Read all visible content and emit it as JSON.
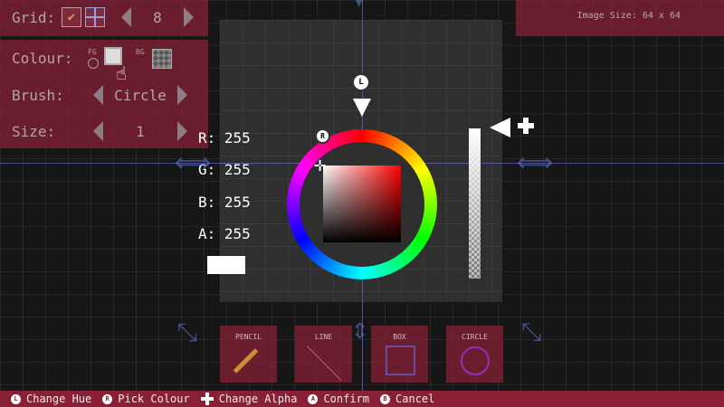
{
  "editor": {
    "grid_label": "Grid:",
    "grid_value": "8",
    "colour_label": "Colour:",
    "fg_label": "FG",
    "bg_label": "BG",
    "brush_label": "Brush:",
    "brush_value": "Circle",
    "size_label": "Size:",
    "size_value": "1",
    "image_size": "Image Size: 64 x 64"
  },
  "color_picker": {
    "r_text": "R: 255",
    "g_text": "G: 255",
    "b_text": "B: 255",
    "a_text": "A: 255",
    "l_badge": "L",
    "r_badge": "R",
    "current_color": "#ffffff",
    "hue_color": "#ff0000"
  },
  "tools": {
    "pencil": "PENCIL",
    "line": "LINE",
    "box": "BOX",
    "circle": "CIRCLE"
  },
  "footer": {
    "l_btn": "L",
    "change_hue": "Change Hue",
    "r_btn": "R",
    "pick_colour": "Pick Colour",
    "change_alpha": "Change Alpha",
    "a_btn": "A",
    "confirm": "Confirm",
    "b_btn": "B",
    "cancel": "Cancel"
  },
  "colors": {
    "panel": "#8a2036",
    "background": "#161616"
  }
}
